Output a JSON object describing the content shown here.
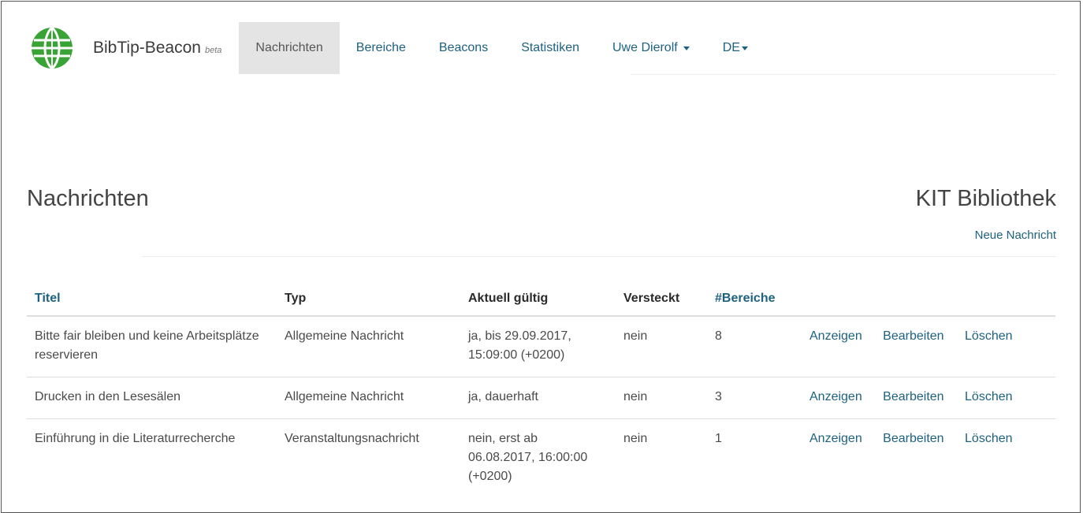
{
  "navbar": {
    "brand": "BibTip-Beacon",
    "brand_sup": "beta",
    "items": [
      {
        "label": "Nachrichten"
      },
      {
        "label": "Bereiche"
      },
      {
        "label": "Beacons"
      },
      {
        "label": "Statistiken"
      }
    ],
    "user_menu": "Uwe Dierolf",
    "language_menu": "DE"
  },
  "page": {
    "title": "Nachrichten",
    "organization": "KIT Bibliothek",
    "new_link": "Neue Nachricht"
  },
  "table": {
    "headers": {
      "title": "Titel",
      "type": "Typ",
      "valid": "Aktuell gültig",
      "hidden": "Versteckt",
      "areas": "#Bereiche"
    },
    "rows": [
      {
        "title": "Bitte fair bleiben und keine Arbeitsplätze reservieren",
        "type": "Allgemeine Nachricht",
        "valid": "ja, bis 29.09.2017, 15:09:00 (+0200)",
        "hidden": "nein",
        "areas": "8"
      },
      {
        "title": "Drucken in den Lesesälen",
        "type": "Allgemeine Nachricht",
        "valid": "ja, dauerhaft",
        "hidden": "nein",
        "areas": "3"
      },
      {
        "title": "Einführung in die Literaturrecherche",
        "type": "Veranstaltungsnachricht",
        "valid": "nein, erst ab 06.08.2017, 16:00:00 (+0200)",
        "hidden": "nein",
        "areas": "1"
      }
    ],
    "actions": {
      "show": "Anzeigen",
      "edit": "Bearbeiten",
      "delete": "Löschen"
    }
  },
  "colors": {
    "link": "#1d6280",
    "logo": "#3aa335",
    "active_tab": "#e4e4e4"
  }
}
